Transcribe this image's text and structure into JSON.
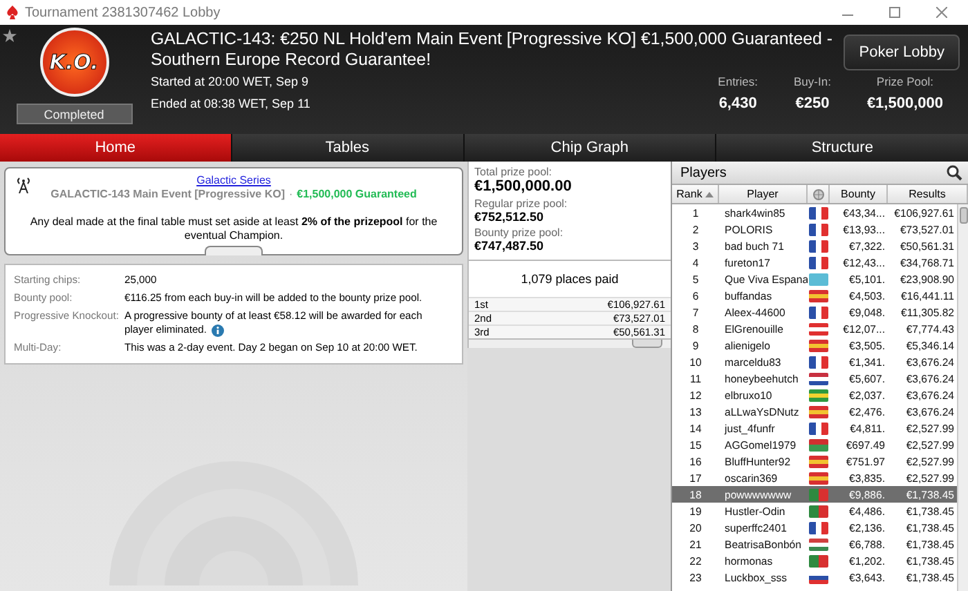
{
  "window": {
    "title": "Tournament 2381307462 Lobby"
  },
  "header": {
    "title": "GALACTIC-143: €250 NL Hold'em Main Event [Progressive KO] €1,500,000 Guaranteed - Southern Europe Record Guarantee!",
    "badge": "K.O.",
    "status": "Completed",
    "started": "Started at 20:00 WET, Sep 9",
    "ended": "Ended at 08:38 WET, Sep 11",
    "lobby_button": "Poker Lobby",
    "stats": [
      {
        "label": "Entries:",
        "value": "6,430"
      },
      {
        "label": "Buy-In:",
        "value": "€250"
      },
      {
        "label": "Prize Pool:",
        "value": "€1,500,000"
      }
    ]
  },
  "tabs": [
    {
      "label": "Home",
      "selected": true
    },
    {
      "label": "Tables",
      "selected": false
    },
    {
      "label": "Chip Graph",
      "selected": false
    },
    {
      "label": "Structure",
      "selected": false
    }
  ],
  "notice": {
    "link": "Galactic Series",
    "subtitle": "GALACTIC-143 Main Event [Progressive KO]",
    "guarantee": "€1,500,000 Guaranteed",
    "separator": "·",
    "text": "Any deal made at the final table must set aside at least **2% of the prizepool** for the eventual Champion."
  },
  "details": [
    {
      "label": "Starting chips:",
      "value": "25,000",
      "info": false
    },
    {
      "label": "Bounty pool:",
      "value": "€116.25 from each buy-in will be added to the bounty prize pool.",
      "info": false
    },
    {
      "label": "Progressive Knockout:",
      "value": "A progressive bounty of at least €58.12 will be awarded for each player eliminated.",
      "info": true
    },
    {
      "label": "Multi-Day:",
      "value": "This was a 2-day event. Day 2 began on Sep 10 at 20:00 WET.",
      "info": false
    }
  ],
  "prizes": {
    "pools": [
      {
        "label": "Total prize pool:",
        "value": "€1,500,000.00"
      },
      {
        "label": "Regular prize pool:",
        "value": "€752,512.50"
      },
      {
        "label": "Bounty prize pool:",
        "value": "€747,487.50"
      }
    ],
    "places_paid": "1,079 places paid",
    "places": [
      {
        "place": "1st",
        "amount": "€106,927.61"
      },
      {
        "place": "2nd",
        "amount": "€73,527.01"
      },
      {
        "place": "3rd",
        "amount": "€50,561.31"
      }
    ]
  },
  "players": {
    "title": "Players",
    "columns": [
      "Rank",
      "Player",
      "Bounty",
      "Results"
    ],
    "rows": [
      {
        "rank": "1",
        "name": "shark4win85",
        "flag": {
          "kind": "vertical",
          "stripes": [
            {
              "color": "#2a4fa8"
            },
            {
              "color": "#ffffff"
            },
            {
              "color": "#e03030"
            }
          ]
        },
        "bounty": "€43,34...",
        "result": "€106,927.61",
        "selected": false
      },
      {
        "rank": "2",
        "name": "POLORIS",
        "flag": {
          "kind": "vertical",
          "stripes": [
            {
              "color": "#2a4fa8"
            },
            {
              "color": "#ffffff"
            },
            {
              "color": "#e03030"
            }
          ]
        },
        "bounty": "€13,93...",
        "result": "€73,527.01",
        "selected": false
      },
      {
        "rank": "3",
        "name": "bad buch 71",
        "flag": {
          "kind": "vertical",
          "stripes": [
            {
              "color": "#2a4fa8"
            },
            {
              "color": "#ffffff"
            },
            {
              "color": "#e03030"
            }
          ]
        },
        "bounty": "€7,322.",
        "result": "€50,561.31",
        "selected": false
      },
      {
        "rank": "4",
        "name": "fureton17",
        "flag": {
          "kind": "vertical",
          "stripes": [
            {
              "color": "#2a4fa8"
            },
            {
              "color": "#ffffff"
            },
            {
              "color": "#e03030"
            }
          ]
        },
        "bounty": "€12,43...",
        "result": "€34,768.71",
        "selected": false
      },
      {
        "rank": "5",
        "name": "Que Viva Espana",
        "flag": {
          "kind": "vertical",
          "stripes": [
            {
              "color": "#5bbcd6"
            }
          ]
        },
        "bounty": "€5,101.",
        "result": "€23,908.90",
        "selected": false
      },
      {
        "rank": "6",
        "name": "buffandas",
        "flag": {
          "kind": "horizontal",
          "stripes": [
            {
              "color": "#d83030"
            },
            {
              "color": "#f2c230"
            },
            {
              "color": "#d83030"
            }
          ]
        },
        "bounty": "€4,503.",
        "result": "€16,441.11",
        "selected": false
      },
      {
        "rank": "7",
        "name": "Aleex-44600",
        "flag": {
          "kind": "vertical",
          "stripes": [
            {
              "color": "#2a4fa8"
            },
            {
              "color": "#ffffff"
            },
            {
              "color": "#e03030"
            }
          ]
        },
        "bounty": "€9,048.",
        "result": "€11,305.82",
        "selected": false
      },
      {
        "rank": "8",
        "name": "ElGrenouille",
        "flag": {
          "kind": "horizontal",
          "stripes": [
            {
              "color": "#e03030"
            },
            {
              "color": "#ffffff"
            },
            {
              "color": "#e03030"
            }
          ]
        },
        "bounty": "€12,07...",
        "result": "€7,774.43",
        "selected": false
      },
      {
        "rank": "9",
        "name": "alienigelo",
        "flag": {
          "kind": "horizontal",
          "stripes": [
            {
              "color": "#d83030"
            },
            {
              "color": "#f2c230"
            },
            {
              "color": "#d83030"
            }
          ]
        },
        "bounty": "€3,505.",
        "result": "€5,346.14",
        "selected": false
      },
      {
        "rank": "10",
        "name": "marceldu83",
        "flag": {
          "kind": "vertical",
          "stripes": [
            {
              "color": "#2a4fa8"
            },
            {
              "color": "#ffffff"
            },
            {
              "color": "#e03030"
            }
          ]
        },
        "bounty": "€1,341.",
        "result": "€3,676.24",
        "selected": false
      },
      {
        "rank": "11",
        "name": "honeybeehutch",
        "flag": {
          "kind": "horizontal",
          "stripes": [
            {
              "color": "#c83040"
            },
            {
              "color": "#ffffff"
            },
            {
              "color": "#2a4fa8"
            }
          ]
        },
        "bounty": "€5,607.",
        "result": "€3,676.24",
        "selected": false
      },
      {
        "rank": "12",
        "name": "elbruxo10",
        "flag": {
          "kind": "horizontal",
          "stripes": [
            {
              "color": "#2e9a40"
            },
            {
              "color": "#f2d230"
            },
            {
              "color": "#2e9a40"
            }
          ]
        },
        "bounty": "€2,037.",
        "result": "€3,676.24",
        "selected": false
      },
      {
        "rank": "13",
        "name": "aLLwaYsDNutz",
        "flag": {
          "kind": "horizontal",
          "stripes": [
            {
              "color": "#d83030"
            },
            {
              "color": "#f2c230"
            },
            {
              "color": "#d83030"
            }
          ]
        },
        "bounty": "€2,476.",
        "result": "€3,676.24",
        "selected": false
      },
      {
        "rank": "14",
        "name": "just_4funfr",
        "flag": {
          "kind": "vertical",
          "stripes": [
            {
              "color": "#2a4fa8"
            },
            {
              "color": "#ffffff"
            },
            {
              "color": "#e03030"
            }
          ]
        },
        "bounty": "€4,811.",
        "result": "€2,527.99",
        "selected": false
      },
      {
        "rank": "15",
        "name": "AGGomel1979",
        "flag": {
          "kind": "horizontal",
          "stripes": [
            {
              "color": "#d03030"
            },
            {
              "color": "#3a9a50"
            }
          ]
        },
        "bounty": "€697.49",
        "result": "€2,527.99",
        "selected": false
      },
      {
        "rank": "16",
        "name": "BluffHunter92",
        "flag": {
          "kind": "horizontal",
          "stripes": [
            {
              "color": "#d83030"
            },
            {
              "color": "#f2c230"
            },
            {
              "color": "#d83030"
            }
          ]
        },
        "bounty": "€751.97",
        "result": "€2,527.99",
        "selected": false
      },
      {
        "rank": "17",
        "name": "oscarin369",
        "flag": {
          "kind": "horizontal",
          "stripes": [
            {
              "color": "#d83030"
            },
            {
              "color": "#f2c230"
            },
            {
              "color": "#d83030"
            }
          ]
        },
        "bounty": "€3,835.",
        "result": "€2,527.99",
        "selected": false
      },
      {
        "rank": "18",
        "name": "powwwwwww",
        "flag": {
          "kind": "vertical",
          "stripes": [
            {
              "color": "#2e8a40"
            },
            {
              "color": "#d83030"
            }
          ]
        },
        "bounty": "€9,886.",
        "result": "€1,738.45",
        "selected": true
      },
      {
        "rank": "19",
        "name": "Hustler-Odin",
        "flag": {
          "kind": "vertical",
          "stripes": [
            {
              "color": "#2e8a40"
            },
            {
              "color": "#d83030"
            }
          ]
        },
        "bounty": "€4,486.",
        "result": "€1,738.45",
        "selected": false
      },
      {
        "rank": "20",
        "name": "superffc2401",
        "flag": {
          "kind": "vertical",
          "stripes": [
            {
              "color": "#2a4fa8"
            },
            {
              "color": "#ffffff"
            },
            {
              "color": "#e03030"
            }
          ]
        },
        "bounty": "€2,136.",
        "result": "€1,738.45",
        "selected": false
      },
      {
        "rank": "21",
        "name": "BeatrisaBonbón",
        "flag": {
          "kind": "horizontal",
          "stripes": [
            {
              "color": "#d04040"
            },
            {
              "color": "#ffffff"
            },
            {
              "color": "#3a8a50"
            }
          ]
        },
        "bounty": "€6,788.",
        "result": "€1,738.45",
        "selected": false
      },
      {
        "rank": "22",
        "name": "hormonas",
        "flag": {
          "kind": "vertical",
          "stripes": [
            {
              "color": "#2e8a40"
            },
            {
              "color": "#d83030"
            }
          ]
        },
        "bounty": "€1,202.",
        "result": "€1,738.45",
        "selected": false
      },
      {
        "rank": "23",
        "name": "Luckbox_sss",
        "flag": {
          "kind": "horizontal",
          "stripes": [
            {
              "color": "#ffffff"
            },
            {
              "color": "#2a4fa8"
            },
            {
              "color": "#e03030"
            }
          ]
        },
        "bounty": "€3,643.",
        "result": "€1,738.45",
        "selected": false
      }
    ]
  }
}
